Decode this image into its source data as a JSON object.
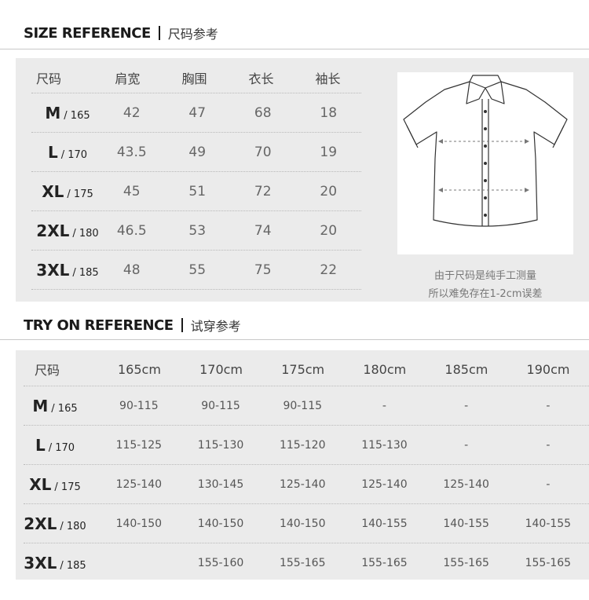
{
  "size_section": {
    "title_en": "SIZE REFERENCE",
    "title_cn": "尺码参考",
    "headers": [
      "尺码",
      "肩宽",
      "胸围",
      "衣长",
      "袖长"
    ],
    "rows": [
      {
        "size": "M",
        "height": "/ 165",
        "values": [
          "42",
          "47",
          "68",
          "18"
        ]
      },
      {
        "size": "L",
        "height": "/ 170",
        "values": [
          "43.5",
          "49",
          "70",
          "19"
        ]
      },
      {
        "size": "XL",
        "height": "/ 175",
        "values": [
          "45",
          "51",
          "72",
          "20"
        ]
      },
      {
        "size": "2XL",
        "height": "/ 180",
        "values": [
          "46.5",
          "53",
          "74",
          "20"
        ]
      },
      {
        "size": "3XL",
        "height": "/ 185",
        "values": [
          "48",
          "55",
          "75",
          "22"
        ]
      }
    ],
    "note_line1": "由于尺码是纯手工测量",
    "note_line2": "所以难免存在1-2cm误差"
  },
  "tryon_section": {
    "title_en": "TRY ON REFERENCE",
    "title_cn": "试穿参考",
    "headers": [
      "尺码",
      "165cm",
      "170cm",
      "175cm",
      "180cm",
      "185cm",
      "190cm"
    ],
    "rows": [
      {
        "size": "M",
        "height": "/ 165",
        "values": [
          "90-115",
          "90-115",
          "90-115",
          "-",
          "-",
          "-"
        ]
      },
      {
        "size": "L",
        "height": "/ 170",
        "values": [
          "115-125",
          "115-130",
          "115-120",
          "115-130",
          "-",
          "-"
        ]
      },
      {
        "size": "XL",
        "height": "/ 175",
        "values": [
          "125-140",
          "130-145",
          "125-140",
          "125-140",
          "125-140",
          "-"
        ]
      },
      {
        "size": "2XL",
        "height": "/ 180",
        "values": [
          "140-150",
          "140-150",
          "140-150",
          "140-155",
          "140-155",
          "140-155"
        ]
      },
      {
        "size": "3XL",
        "height": "/ 185",
        "values": [
          "",
          "155-160",
          "155-165",
          "155-165",
          "155-165",
          "155-165"
        ]
      }
    ]
  },
  "icons": {
    "shirt": "short-sleeve-shirt-diagram-icon"
  }
}
